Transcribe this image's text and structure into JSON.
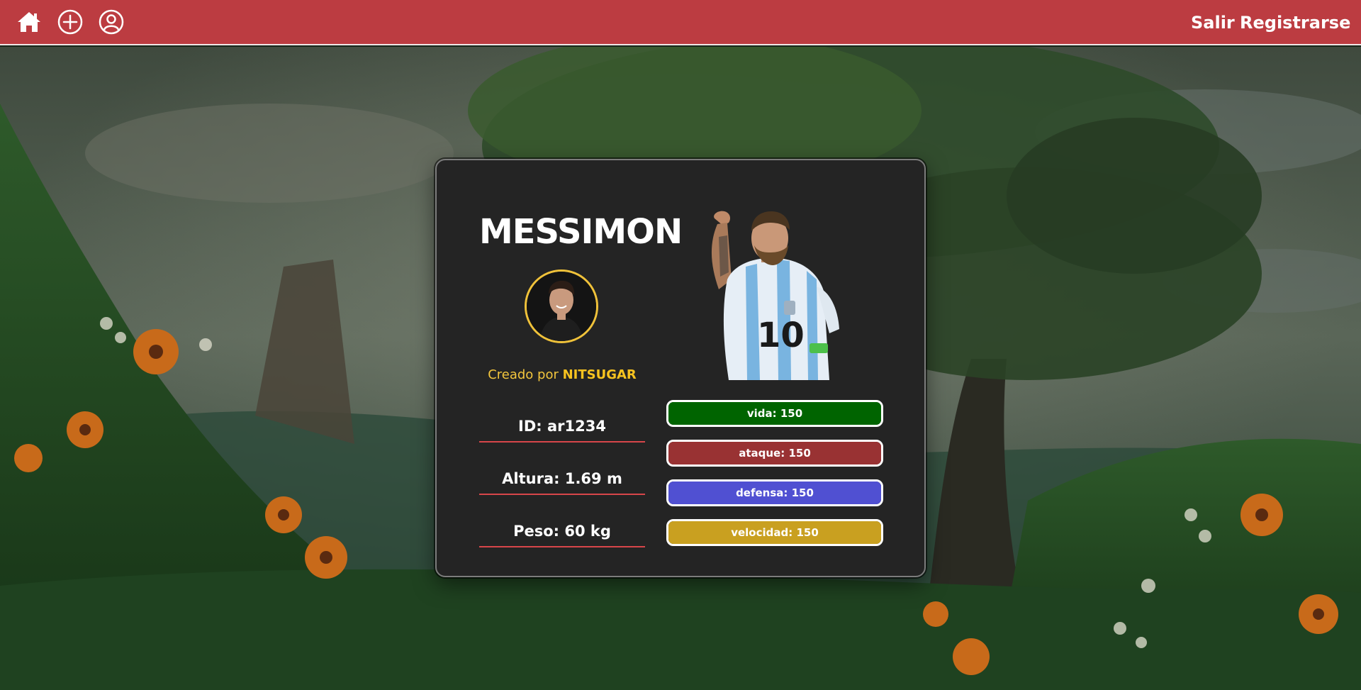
{
  "header": {
    "icons": [
      "home-icon",
      "plus-circle-icon",
      "user-circle-icon"
    ],
    "links": {
      "salir": "Salir",
      "registrarse": "Registrarse"
    },
    "background_color": "#bc3c41"
  },
  "card": {
    "name": "MESSIMON",
    "creator_prefix": "Creado por",
    "creator_name": "NITSUGAR",
    "info": {
      "id": "ID: ar1234",
      "altura": "Altura: 1.69 m",
      "peso": "Peso: 60 kg"
    },
    "stats": [
      {
        "key": "vida",
        "label": "vida: 150",
        "value": 150,
        "fill": 1.0,
        "color": "#006400"
      },
      {
        "key": "ataque",
        "label": "ataque: 150",
        "value": 150,
        "fill": 1.0,
        "color": "#993233"
      },
      {
        "key": "defensa",
        "label": "defensa: 150",
        "value": 150,
        "fill": 1.0,
        "color": "#5050d2"
      },
      {
        "key": "velocidad",
        "label": "velocidad: 150",
        "value": 150,
        "fill": 1.0,
        "color": "#c9a020"
      }
    ],
    "accent_color": "#f2c53d",
    "divider_color": "#d8464a"
  }
}
